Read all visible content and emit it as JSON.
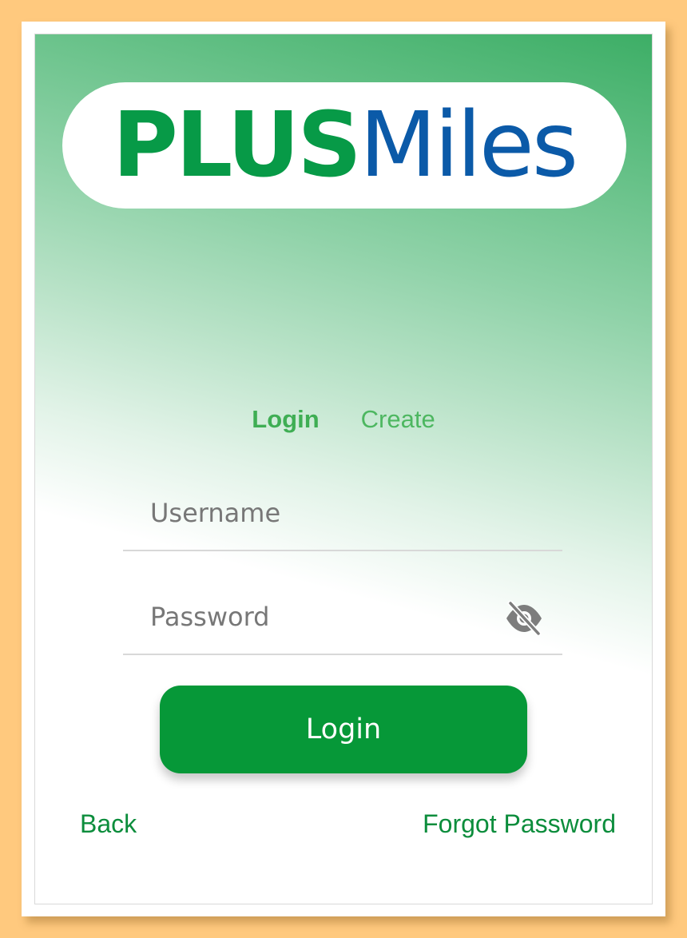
{
  "brand": {
    "logo_part1": "PLUS",
    "logo_part2": "Miles",
    "colors": {
      "plus_green": "#079a47",
      "miles_blue": "#0b5aa8",
      "accent_green": "#069838",
      "link_green": "#0c8d3c"
    }
  },
  "tabs": {
    "login": "Login",
    "create": "Create",
    "active": "login"
  },
  "form": {
    "username_placeholder": "Username",
    "username_value": "",
    "password_placeholder": "Password",
    "password_value": "",
    "password_toggle_icon": "eye-slash-icon",
    "submit_label": "Login"
  },
  "footer": {
    "back_label": "Back",
    "forgot_label": "Forgot Password"
  }
}
